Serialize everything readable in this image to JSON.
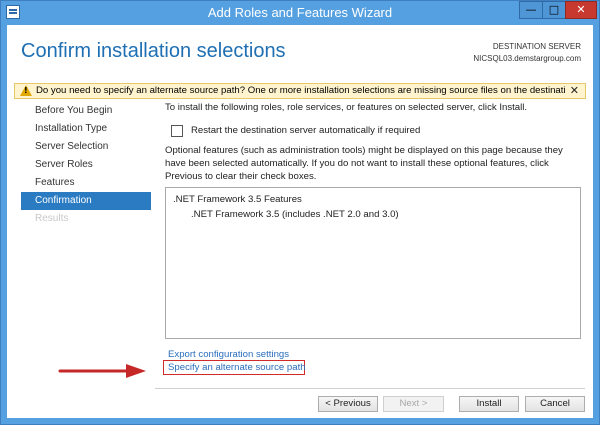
{
  "window": {
    "title": "Add Roles and Features Wizard",
    "controls": {
      "minimize": "—",
      "maximize": "□",
      "close": "✕"
    }
  },
  "header": {
    "page_title": "Confirm installation selections",
    "destination_label": "DESTINATION SERVER",
    "destination_server": "NICSQL03.demstargroup.com"
  },
  "warning": {
    "text": "Do you need to specify an alternate source path? One or more installation selections are missing source files on the destinati...",
    "close": "✕"
  },
  "sidebar": {
    "items": [
      {
        "label": "Before You Begin",
        "state": "normal"
      },
      {
        "label": "Installation Type",
        "state": "normal"
      },
      {
        "label": "Server Selection",
        "state": "normal"
      },
      {
        "label": "Server Roles",
        "state": "normal"
      },
      {
        "label": "Features",
        "state": "normal"
      },
      {
        "label": "Confirmation",
        "state": "active"
      },
      {
        "label": "Results",
        "state": "disabled"
      }
    ]
  },
  "main": {
    "intro": "To install the following roles, role services, or features on selected server, click Install.",
    "restart_checkbox": {
      "label": "Restart the destination server automatically if required",
      "checked": false
    },
    "optional_note": "Optional features (such as administration tools) might be displayed on this page because they have been selected automatically. If you do not want to install these optional features, click Previous to clear their check boxes.",
    "features": [
      ".NET Framework 3.5 Features",
      ".NET Framework 3.5 (includes .NET 2.0 and 3.0)"
    ],
    "export_link": "Export configuration settings",
    "alternate_source_link": "Specify an alternate source path"
  },
  "buttons": {
    "previous": "< Previous",
    "next": "Next >",
    "install": "Install",
    "cancel": "Cancel"
  },
  "colors": {
    "titlebar": "#55a0e0",
    "accent": "#1e6fb3",
    "active_item": "#2a7bc2",
    "highlight_box": "#d02a2a",
    "arrow": "#c62828"
  }
}
